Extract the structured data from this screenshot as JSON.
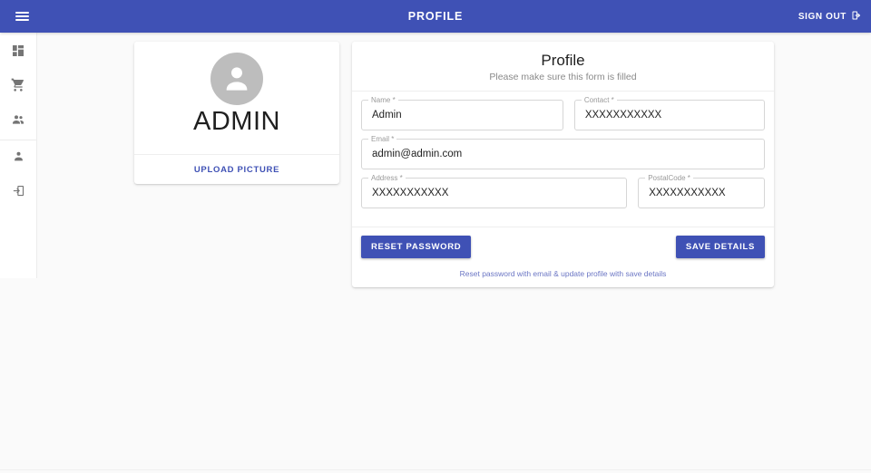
{
  "appbar": {
    "menu_icon": "hamburger-menu-icon",
    "title": "PROFILE",
    "signout_label": "SIGN OUT",
    "signout_icon": "logout-icon",
    "background_color": "#3f51b5",
    "text_color": "#ffffff"
  },
  "sidebar": {
    "items": [
      {
        "name": "dashboard",
        "icon": "dashboard-grid-icon"
      },
      {
        "name": "orders",
        "icon": "shopping-cart-icon"
      },
      {
        "name": "customers",
        "icon": "people-group-icon"
      }
    ],
    "items_secondary": [
      {
        "name": "profile",
        "icon": "person-icon"
      },
      {
        "name": "login",
        "icon": "login-box-icon"
      }
    ]
  },
  "profile_card": {
    "avatar_icon": "person-avatar-icon",
    "avatar_color": "#bdbdbd",
    "display_name": "ADMIN",
    "upload_label": "UPLOAD PICTURE"
  },
  "form": {
    "title": "Profile",
    "subtitle": "Please make sure this form is filled",
    "fields": {
      "name": {
        "label": "Name *",
        "value": "Admin",
        "placeholder": "Name"
      },
      "contact": {
        "label": "Contact *",
        "value": "XXXXXXXXXXX",
        "placeholder": "Contact"
      },
      "email": {
        "label": "Email *",
        "value": "admin@admin.com",
        "placeholder": "Email"
      },
      "address": {
        "label": "Address *",
        "value": "XXXXXXXXXXX",
        "placeholder": "Address"
      },
      "postal": {
        "label": "PostalCode *",
        "value": "XXXXXXXXXXX",
        "placeholder": "PostalCode"
      }
    },
    "reset_button": "RESET PASSWORD",
    "save_button": "SAVE DETAILS",
    "hint": "Reset password with email & update profile with save details",
    "accent_color": "#3f51b5",
    "hint_color": "#6b76c4"
  }
}
